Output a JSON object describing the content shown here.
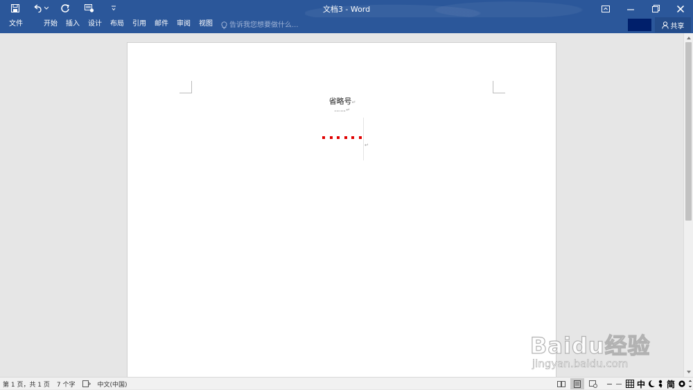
{
  "window": {
    "title": "文档3 - Word"
  },
  "quick_access": {
    "icons": [
      "save-icon",
      "undo-icon",
      "undo-dropdown-icon",
      "redo-icon",
      "touch-mode-icon",
      "customize-qat-icon"
    ]
  },
  "window_controls": {
    "icons": [
      "ribbon-display-options-icon",
      "minimize-icon",
      "restore-icon",
      "close-icon"
    ]
  },
  "ribbon": {
    "tabs": [
      {
        "label": "文件"
      },
      {
        "label": "开始"
      },
      {
        "label": "插入"
      },
      {
        "label": "设计"
      },
      {
        "label": "布局"
      },
      {
        "label": "引用"
      },
      {
        "label": "邮件"
      },
      {
        "label": "审阅"
      },
      {
        "label": "视图"
      }
    ],
    "tell_me_placeholder": "告诉我您想要做什么...",
    "share_label": "共享"
  },
  "document": {
    "heading": "省略号",
    "line2": "……",
    "red_dots_count": 6,
    "paragraph_mark": "↵"
  },
  "status": {
    "page": "第 1 页，共 1 页",
    "words": "7 个字",
    "language": "中文(中国)",
    "ime": {
      "mode": "中",
      "punct": "简"
    }
  },
  "watermark": {
    "logo": "Baidu经验",
    "url": "jingyan.baidu.com"
  },
  "colors": {
    "ribbon": "#2b579a",
    "account_box": "#001f6b",
    "red_dots": "#e00000"
  }
}
